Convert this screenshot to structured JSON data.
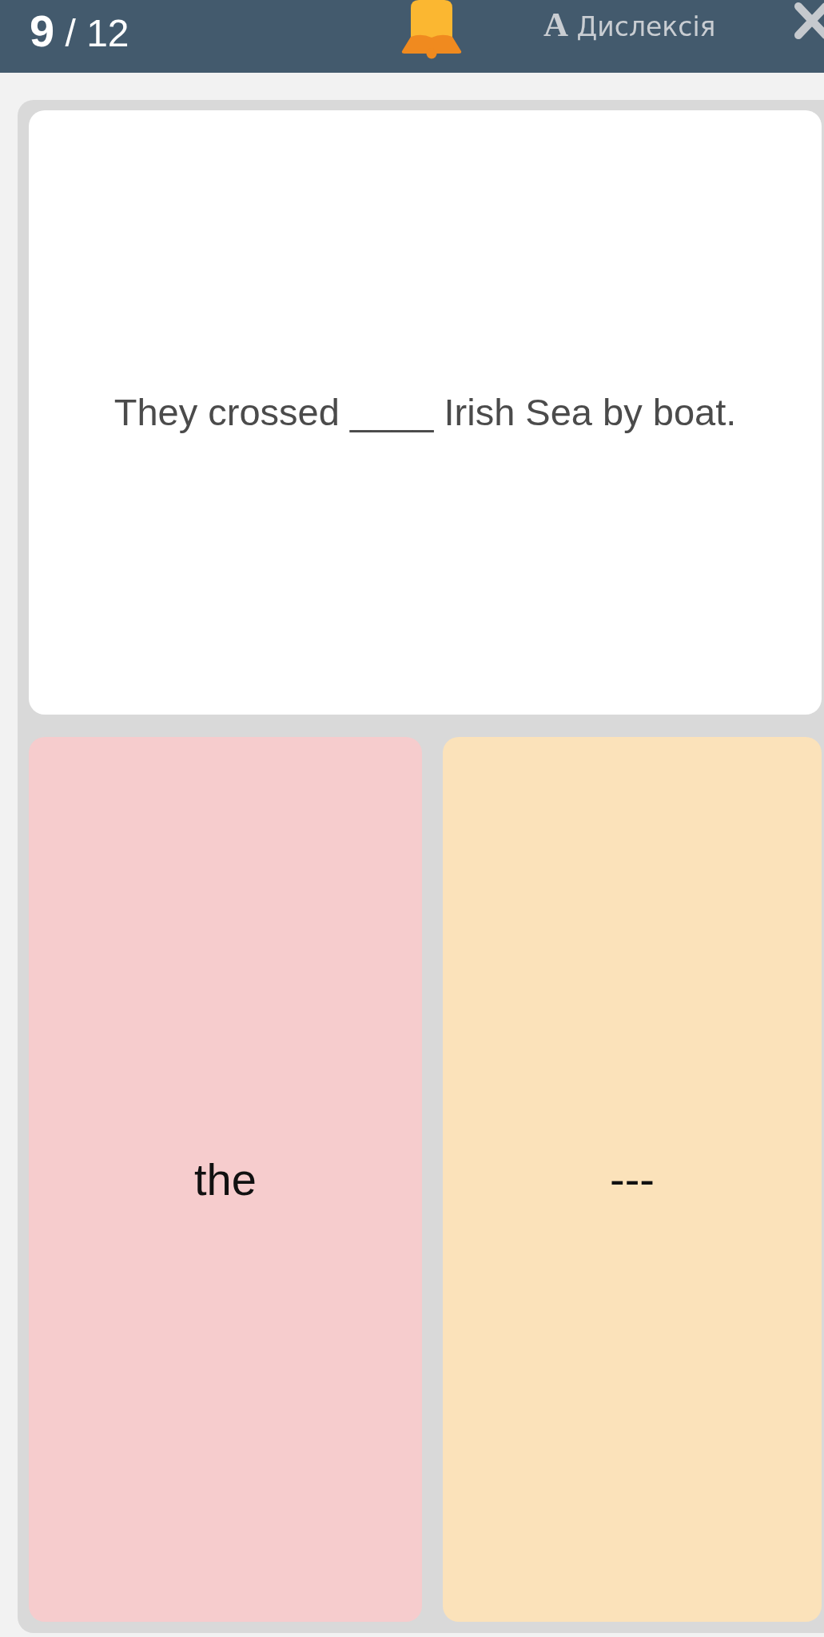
{
  "header": {
    "progress": "**9** / 12",
    "dyslexia_toggle": {
      "label": "**A** Дислексія"
    }
  },
  "question": {
    "text": "They crossed ____ Irish Sea by boat."
  },
  "answers": [
    {
      "text": "the",
      "color": "#f6cccd"
    },
    {
      "text": "---",
      "color": "#fbe2ba"
    }
  ]
}
